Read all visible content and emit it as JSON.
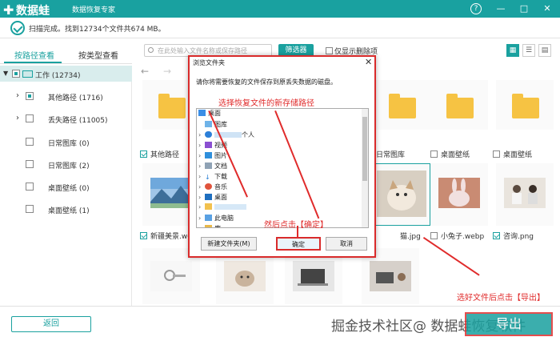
{
  "app": {
    "name": "数据蛙",
    "subtitle": "数据恢复专家",
    "colors": {
      "accent": "#1aa19f",
      "annotation": "#e02b2b"
    }
  },
  "window_buttons": [
    "?",
    "—",
    "□",
    "✕"
  ],
  "status": {
    "text": "扫描完成。找到12734个文件共674 MB。"
  },
  "tabs": [
    {
      "label": "按路径查看",
      "active": true
    },
    {
      "label": "按类型查看",
      "active": false
    }
  ],
  "tree": [
    {
      "label": "工作 (12734)",
      "level": 0,
      "expander": "▼",
      "state": "partial",
      "icon": "computer-icon",
      "selected": true
    },
    {
      "label": "其他路径 (1716)",
      "level": 1,
      "expander": "›",
      "state": "partial"
    },
    {
      "label": "丢失路径 (11005)",
      "level": 1,
      "expander": "›",
      "state": "empty"
    },
    {
      "label": "日常图库 (0)",
      "level": 1,
      "expander": "",
      "state": "empty"
    },
    {
      "label": "日常图库 (2)",
      "level": 1,
      "expander": "",
      "state": "empty"
    },
    {
      "label": "桌面壁纸 (0)",
      "level": 1,
      "expander": "",
      "state": "empty"
    },
    {
      "label": "桌面壁纸 (1)",
      "level": 1,
      "expander": "",
      "state": "empty"
    }
  ],
  "toolbar": {
    "search_placeholder": "在此处输入文件名称或保存路径",
    "filter_label": "筛选器",
    "only_deleted_label": "仅显示删除项",
    "view_buttons": [
      "grid-view-icon",
      "list-view-icon",
      "detail-view-icon"
    ]
  },
  "nav": {
    "back": "←",
    "forward": "→"
  },
  "tiles_row1": [
    {
      "caption": "其他路径",
      "checked": true,
      "type": "folder"
    },
    {
      "caption": "日常图库",
      "checked": false,
      "type": "folder"
    },
    {
      "caption": "桌面壁纸",
      "checked": false,
      "type": "folder"
    },
    {
      "caption": "桌面壁纸",
      "checked": false,
      "type": "folder"
    }
  ],
  "tiles_row2": [
    {
      "caption": "新疆美景.we",
      "checked": true,
      "type": "landscape-photo"
    },
    {
      "caption": "猫.jpg",
      "checked": false,
      "type": "cat-photo"
    },
    {
      "caption": "小兔子.webp",
      "checked": false,
      "type": "rabbit-photo"
    },
    {
      "caption": "咨询.png",
      "checked": true,
      "type": "office-photo"
    }
  ],
  "tiles_row3": [
    {
      "type": "keychain-photo"
    },
    {
      "type": "dog-photo"
    },
    {
      "type": "laptop-photo"
    },
    {
      "type": "desk-photo"
    }
  ],
  "dialog": {
    "title": "浏览文件夹",
    "message": "请你将需要恢复的文件保存到原丢失数据的磁盘。",
    "tree": [
      {
        "label": "桌面",
        "level": 0,
        "icon": "desktop-folder-icon",
        "expander": ""
      },
      {
        "label": "图库",
        "level": 1,
        "icon": "gallery-icon",
        "expander": ""
      },
      {
        "label": "个人",
        "level": 1,
        "icon": "cloud-icon",
        "expander": "›"
      },
      {
        "label": "视频",
        "level": 1,
        "icon": "video-icon",
        "expander": "›"
      },
      {
        "label": "图片",
        "level": 1,
        "icon": "picture-icon",
        "expander": "›"
      },
      {
        "label": "文档",
        "level": 1,
        "icon": "document-icon",
        "expander": "›"
      },
      {
        "label": "下载",
        "level": 1,
        "icon": "download-icon",
        "expander": "›"
      },
      {
        "label": "音乐",
        "level": 1,
        "icon": "music-icon",
        "expander": "›"
      },
      {
        "label": "桌面",
        "level": 1,
        "icon": "desktop-icon",
        "expander": "›"
      },
      {
        "label": "",
        "level": 1,
        "icon": "folder-icon",
        "expander": "›"
      },
      {
        "label": "此电脑",
        "level": 1,
        "icon": "computer-icon",
        "expander": "›"
      },
      {
        "label": "库",
        "level": 1,
        "icon": "library-icon",
        "expander": "›"
      }
    ],
    "new_folder_label": "新建文件夹(M)",
    "ok_label": "确定",
    "cancel_label": "取消"
  },
  "annotations": {
    "select_path": "选择恢复文件的新存储路径",
    "click_ok": "然后点击【确定】",
    "click_export": "选好文件后点击【导出】"
  },
  "bottom": {
    "back_label": "返回",
    "watermark": "掘金技术社区@ 数据蛙恢复软件",
    "export_label": "导出"
  }
}
